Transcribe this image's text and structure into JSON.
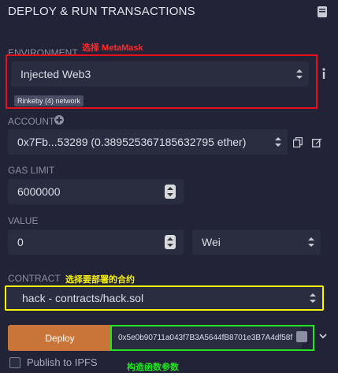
{
  "header": {
    "title": "DEPLOY & RUN TRANSACTIONS"
  },
  "annotations": {
    "environment": "选择 MetaMask",
    "contract": "选择要部署的合约",
    "constructor": "构造函数参数"
  },
  "environment": {
    "label": "ENVIRONMENT",
    "value": "Injected Web3",
    "network_badge": "Rinkeby (4) network"
  },
  "account": {
    "label": "ACCOUNT",
    "value": "0x7Fb...53289 (0.389525367185632795 ether)"
  },
  "gas_limit": {
    "label": "GAS LIMIT",
    "value": "6000000"
  },
  "value": {
    "label": "VALUE",
    "amount": "0",
    "unit": "Wei"
  },
  "contract": {
    "label": "CONTRACT",
    "selected": "hack - contracts/hack.sol"
  },
  "deploy": {
    "button_label": "Deploy",
    "constructor_args": "0x5e0b90711a043f7B3A5644fB8701e3B7A4df58f"
  },
  "publish": {
    "label": "Publish to IPFS",
    "checked": false
  },
  "colors": {
    "background": "#222336",
    "field": "#2a2c3f",
    "deploy": "#c97539",
    "annot_red": "#e4101c",
    "annot_yellow": "#f7f30c",
    "annot_green": "#21e521"
  }
}
